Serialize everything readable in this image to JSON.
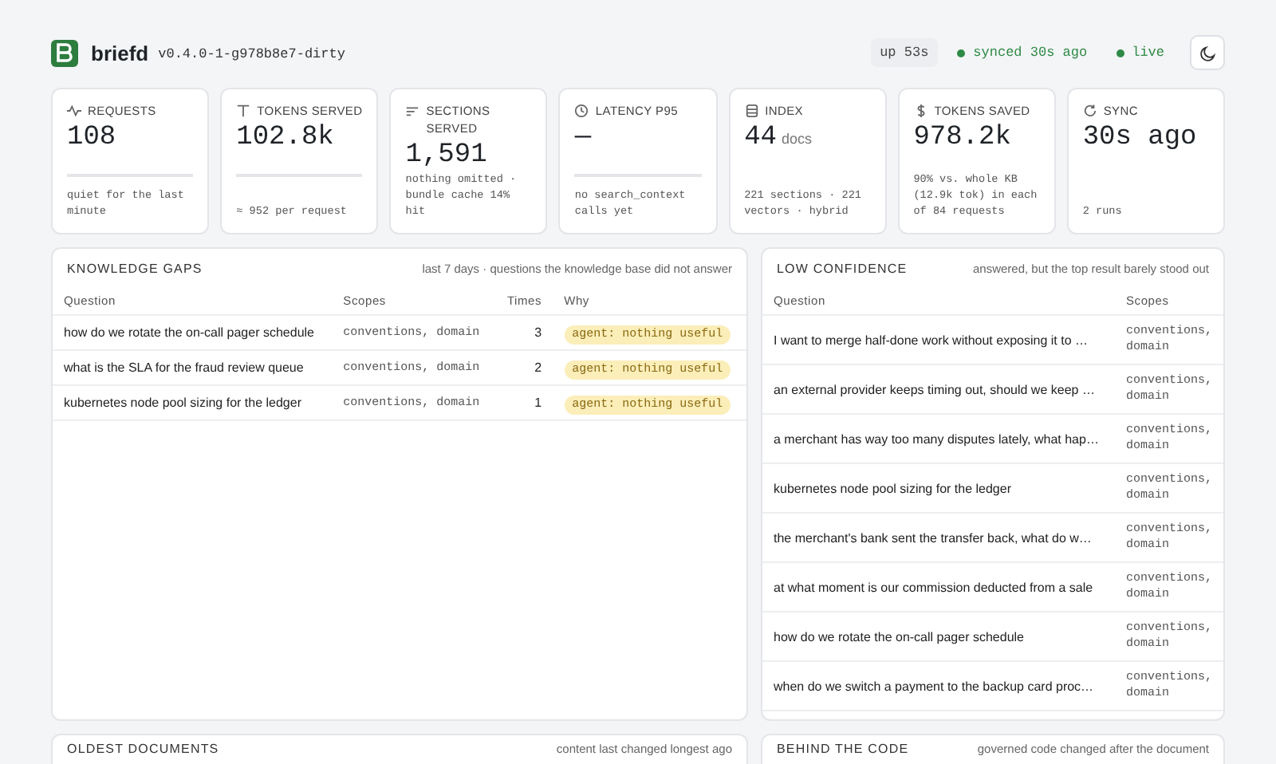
{
  "header": {
    "app_name": "briefd",
    "version": "v0.4.0-1-g978b8e7-dirty",
    "pills": [
      {
        "text": "up 53s"
      },
      {
        "text": "synced 30s ago",
        "color": "#2f8a46"
      },
      {
        "text": "live",
        "color": "#2f8a46"
      }
    ]
  },
  "stats": [
    {
      "label": "REQUESTS",
      "value": "108",
      "sparkline": true,
      "note": "quiet for the last minute"
    },
    {
      "label": "TOKENS SERVED",
      "value": "102.8k",
      "sparkline": true,
      "note": "≈ 952 per request"
    },
    {
      "label": "SECTIONS SERVED",
      "value": "1,591",
      "sparkline": false,
      "note": "nothing omitted · bundle cache 14% hit"
    },
    {
      "label": "LATENCY P95",
      "value": "—",
      "sparkline": true,
      "note": "no search_context calls yet"
    },
    {
      "label": "INDEX",
      "value": "44",
      "unit": "docs",
      "sparkline": false,
      "note": "221 sections · 221 vectors · hybrid"
    },
    {
      "label": "TOKENS SAVED",
      "value": "978.2k",
      "sparkline": false,
      "note": "90% vs. whole KB (12.9k tok) in each of 84 requests"
    },
    {
      "label": "SYNC",
      "value": "30s ago",
      "sparkline": false,
      "note": "2 runs"
    }
  ],
  "knowledge_gaps": {
    "title": "KNOWLEDGE GAPS",
    "note": "last 7 days · questions the knowledge base did not answer",
    "columns": [
      "Question",
      "Scopes",
      "Times",
      "Why"
    ],
    "rows": [
      {
        "question": "how do we rotate the on-call pager schedule",
        "scopes": "conventions, domain",
        "times": "3",
        "why": "agent: nothing useful"
      },
      {
        "question": "what is the SLA for the fraud review queue",
        "scopes": "conventions, domain",
        "times": "2",
        "why": "agent: nothing useful"
      },
      {
        "question": "kubernetes node pool sizing for the ledger",
        "scopes": "conventions, domain",
        "times": "1",
        "why": "agent: nothing useful"
      }
    ]
  },
  "low_confidence": {
    "title": "LOW CONFIDENCE",
    "note": "answered, but the top result barely stood out",
    "columns": [
      "Question",
      "Scopes"
    ],
    "rows": [
      {
        "question": "I want to merge half-done work without exposing it to …",
        "scopes": "conventions, domain"
      },
      {
        "question": "an external provider keeps timing out, should we keep …",
        "scopes": "conventions, domain"
      },
      {
        "question": "a merchant has way too many disputes lately, what hap…",
        "scopes": "conventions, domain"
      },
      {
        "question": "kubernetes node pool sizing for the ledger",
        "scopes": "conventions, domain"
      },
      {
        "question": "the merchant's bank sent the transfer back, what do w…",
        "scopes": "conventions, domain"
      },
      {
        "question": "at what moment is our commission deducted from a sale",
        "scopes": "conventions, domain"
      },
      {
        "question": "how do we rotate the on-call pager schedule",
        "scopes": "conventions, domain"
      },
      {
        "question": "when do we switch a payment to the backup card proc…",
        "scopes": "conventions, domain"
      }
    ]
  },
  "oldest_documents": {
    "title": "OLDEST DOCUMENTS",
    "note": "content last changed longest ago"
  },
  "behind_the_code": {
    "title": "BEHIND THE CODE",
    "note": "governed code changed after the document"
  }
}
